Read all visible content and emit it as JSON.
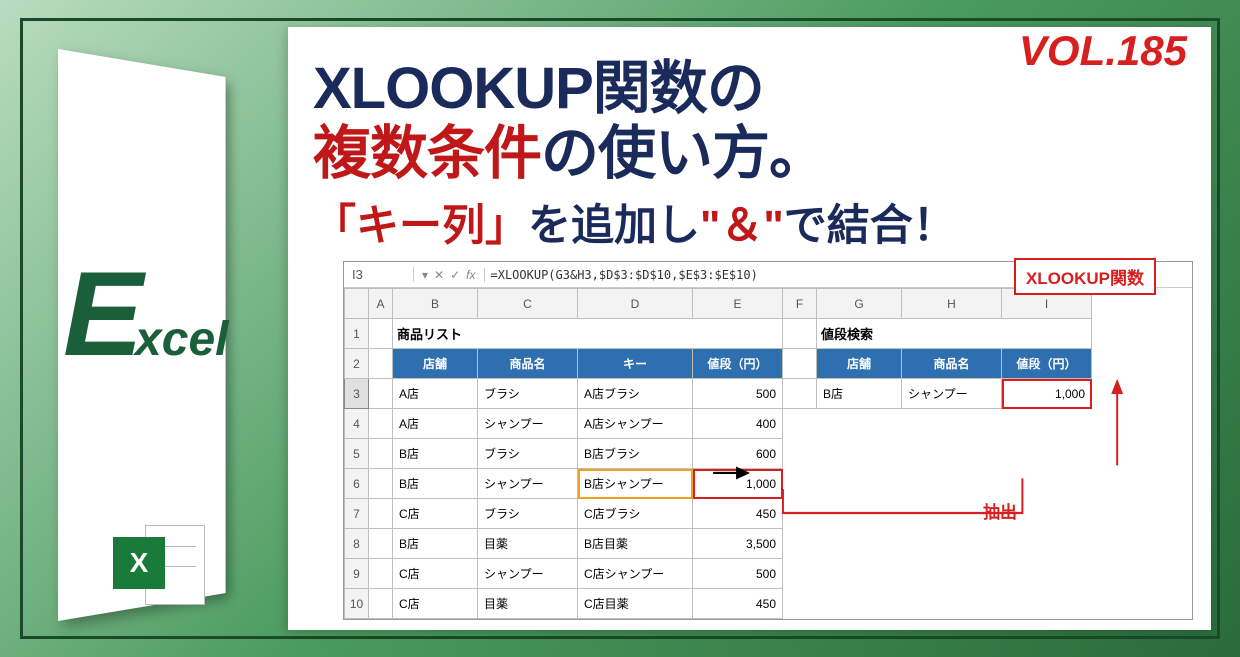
{
  "volume": "VOL.185",
  "logo": {
    "big": "E",
    "rest": "xcel",
    "badge": "X"
  },
  "title": {
    "seg1": "XLOOKUP関数",
    "seg2": "の",
    "seg3": "複数条件",
    "seg4": "の使い方。"
  },
  "subtitle": {
    "seg1": "「キー列」",
    "seg2": "を追加し",
    "seg3": "\"＆\"",
    "seg4": "で結合！"
  },
  "labels": {
    "xlookup_tag": "XLOOKUP関数",
    "extract": "抽出"
  },
  "sheet": {
    "name_box": "I3",
    "fx_label": "fx",
    "formula": "=XLOOKUP(G3&H3,$D$3:$D$10,$E$3:$E$10)",
    "col_headers": [
      "A",
      "B",
      "C",
      "D",
      "E",
      "F",
      "G",
      "H",
      "I"
    ],
    "section_left": "商品リスト",
    "section_right": "値段検索",
    "left_headers": [
      "店舗",
      "商品名",
      "キー",
      "値段（円）"
    ],
    "right_headers": [
      "店舗",
      "商品名",
      "値段（円）"
    ],
    "left_rows": [
      {
        "r": "3",
        "a": "A店",
        "b": "ブラシ",
        "c": "A店ブラシ",
        "d": "500"
      },
      {
        "r": "4",
        "a": "A店",
        "b": "シャンプー",
        "c": "A店シャンプー",
        "d": "400"
      },
      {
        "r": "5",
        "a": "B店",
        "b": "ブラシ",
        "c": "B店ブラシ",
        "d": "600"
      },
      {
        "r": "6",
        "a": "B店",
        "b": "シャンプー",
        "c": "B店シャンプー",
        "d": "1,000"
      },
      {
        "r": "7",
        "a": "C店",
        "b": "ブラシ",
        "c": "C店ブラシ",
        "d": "450"
      },
      {
        "r": "8",
        "a": "B店",
        "b": "目薬",
        "c": "B店目薬",
        "d": "3,500"
      },
      {
        "r": "9",
        "a": "C店",
        "b": "シャンプー",
        "c": "C店シャンプー",
        "d": "500"
      },
      {
        "r": "10",
        "a": "C店",
        "b": "目薬",
        "c": "C店目薬",
        "d": "450"
      }
    ],
    "right_row": {
      "a": "B店",
      "b": "シャンプー",
      "c": "1,000"
    }
  },
  "col_widths": {
    "A": 24,
    "B": 85,
    "C": 100,
    "D": 115,
    "E": 90,
    "F": 34,
    "G": 85,
    "H": 100,
    "I": 90
  }
}
